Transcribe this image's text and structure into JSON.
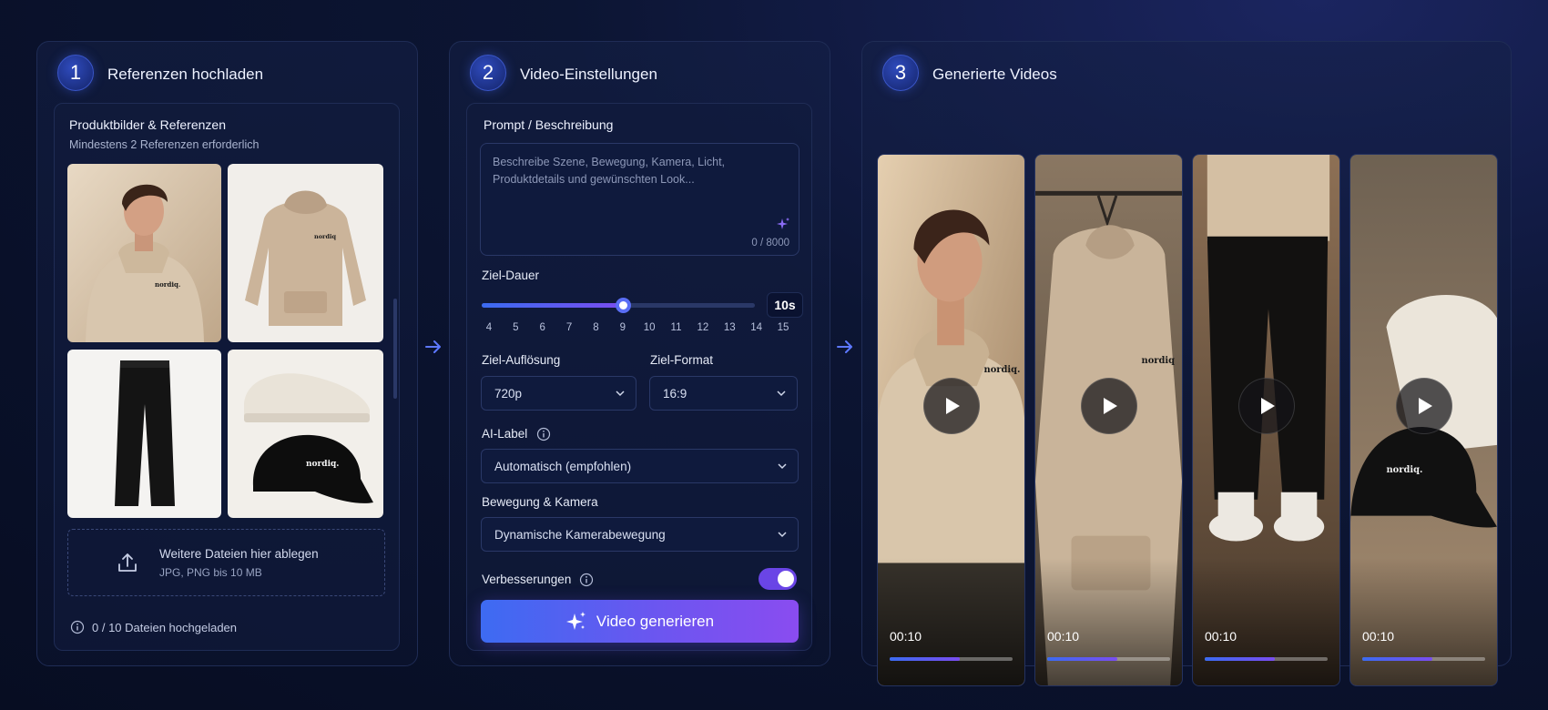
{
  "colors": {
    "accent_start": "#3d6bf2",
    "accent_end": "#8a4cf0",
    "panel_border": "#1f2c55",
    "background": "#070d22"
  },
  "step1": {
    "number": "1",
    "title": "Referenzen hochladen",
    "card_title": "Produktbilder & Referenzen",
    "card_subtitle": "Mindestens 2 Referenzen erforderlich",
    "images": [
      {
        "name": "model-hoodie-thumb",
        "brand": "nordiq."
      },
      {
        "name": "hoodie-product-thumb",
        "brand": "nordiq"
      },
      {
        "name": "pants-thumb"
      },
      {
        "name": "sneaker-cap-thumb",
        "brand": "nordiq."
      }
    ],
    "dropzone_title": "Weitere Dateien hier ablegen",
    "dropzone_hint": "JPG, PNG bis 10 MB",
    "upload_status": "0 / 10 Dateien hochgeladen",
    "icons": {
      "upload": "upload-icon",
      "info": "info-icon"
    }
  },
  "step2": {
    "number": "2",
    "title": "Video-Einstellungen",
    "prompt_label": "Prompt / Beschreibung",
    "prompt_placeholder_line1": "Beschreibe Szene, Bewegung, Kamera, Licht,",
    "prompt_placeholder_line2": "Produktdetails und gewünschten Look...",
    "char_count": "0 / 8000",
    "duration_label": "Ziel-Dauer",
    "duration_value": "10s",
    "duration_current": 9,
    "duration_ticks": [
      "4",
      "5",
      "6",
      "7",
      "8",
      "9",
      "10",
      "11",
      "12",
      "13",
      "14",
      "15"
    ],
    "resolution_label": "Ziel-Auflösung",
    "resolution_value": "720p",
    "format_label": "Ziel-Format",
    "format_value": "16:9",
    "ai_label_label": "AI-Label",
    "ai_label_value": "Automatisch (empfohlen)",
    "motion_label": "Bewegung & Kamera",
    "motion_value": "Dynamische Kamerabewegung",
    "improvements_label": "Verbesserungen",
    "improvements_on": true,
    "generate_button": "Video generieren"
  },
  "step3": {
    "number": "3",
    "title": "Generierte Videos",
    "videos": [
      {
        "time": "00:10",
        "progress": 0.57,
        "brand": "nordiq."
      },
      {
        "time": "00:10",
        "progress": 0.57,
        "brand": "nordiq"
      },
      {
        "time": "00:10",
        "progress": 0.57
      },
      {
        "time": "00:10",
        "progress": 0.57,
        "brand": "nordiq."
      }
    ]
  }
}
